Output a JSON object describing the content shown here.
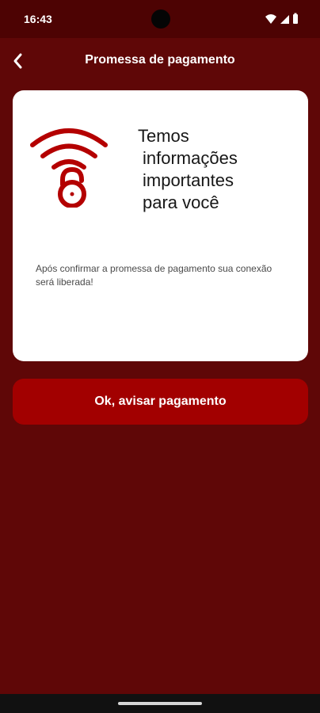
{
  "status_bar": {
    "time": "16:43",
    "icons": [
      "wifi-icon",
      "signal-icon",
      "battery-icon"
    ]
  },
  "app_bar": {
    "title": "Promessa de pagamento",
    "back_icon": "back-arrow-icon"
  },
  "card": {
    "icon": "wifi-lock-icon",
    "headline_lines": [
      "Temos",
      "informações",
      "importantes",
      "para você"
    ],
    "message": "Após confirmar a promessa de pagamento sua conexão será liberada!"
  },
  "actions": {
    "confirm_label": "Ok, avisar pagamento"
  },
  "colors": {
    "background": "#5f0707",
    "status_bar": "#4d0303",
    "primary": "#a20000",
    "card": "#ffffff",
    "icon_accent": "#b40000"
  }
}
